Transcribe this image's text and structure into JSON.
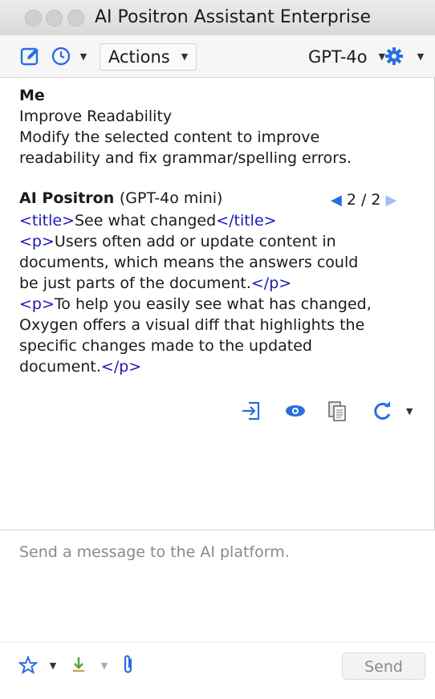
{
  "window": {
    "title": "AI Positron Assistant Enterprise"
  },
  "toolbar": {
    "actions_label": "Actions",
    "model_label": "GPT-4o",
    "icons": [
      "new-chat-icon",
      "history-icon",
      "settings-gear-icon"
    ]
  },
  "conversation": {
    "user": {
      "sender": "Me",
      "action": "Improve Readability",
      "description_lines": [
        "Modify the selected content to improve",
        "readability and fix grammar/spelling errors."
      ]
    },
    "assistant": {
      "sender": "AI Positron",
      "model": "(GPT-4o mini)",
      "navigation": "2 / 2",
      "lines": [
        {
          "open": "<title>",
          "text": "See what changed",
          "close": "</title>"
        },
        {
          "open": "<p>",
          "text": "Users often add or update content in",
          "close": ""
        },
        {
          "open": "",
          "text": "documents, which means the answers could",
          "close": ""
        },
        {
          "open": "",
          "text": "be just parts of the document.",
          "close": "</p>"
        },
        {
          "open": "<p>",
          "text": "To help you easily see what has changed,",
          "close": ""
        },
        {
          "open": "",
          "text": "Oxygen offers a visual diff that highlights the",
          "close": ""
        },
        {
          "open": "",
          "text": "specific changes made to the updated",
          "close": ""
        },
        {
          "open": "",
          "text": "document.",
          "close": "</p>"
        }
      ],
      "message_actions": [
        "insert-icon",
        "preview-eye-icon",
        "copy-icon",
        "regenerate-icon"
      ]
    }
  },
  "input": {
    "placeholder": "Send a message to the AI platform."
  },
  "bottom": {
    "send_label": "Send",
    "icons": [
      "favorites-star-icon",
      "import-icon",
      "attach-paperclip-icon"
    ]
  },
  "colors": {
    "tag": "#1c16b8",
    "accent": "#2a6ee0",
    "placeholder": "#8a8a8a"
  }
}
